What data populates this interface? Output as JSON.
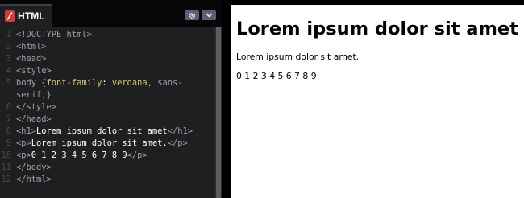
{
  "editor": {
    "tab_label": "HTML",
    "badge_icon": "slash",
    "controls": [
      "gear-icon",
      "chevron-down-icon"
    ],
    "lines": [
      {
        "num": "1",
        "parts": [
          {
            "t": "<!DOCTYPE html>",
            "c": "tag"
          }
        ]
      },
      {
        "num": "2",
        "parts": [
          {
            "t": "<html>",
            "c": "tag"
          }
        ]
      },
      {
        "num": "3",
        "parts": [
          {
            "t": "<head>",
            "c": "tag"
          }
        ]
      },
      {
        "num": "4",
        "parts": [
          {
            "t": "<style>",
            "c": "tag"
          }
        ]
      },
      {
        "num": "5",
        "parts": [
          {
            "t": "body {",
            "c": "tag"
          },
          {
            "t": "font-family",
            "c": "prop"
          },
          {
            "t": ": ",
            "c": "text"
          },
          {
            "t": "verdana",
            "c": "prop"
          },
          {
            "t": ", sans-",
            "c": "val"
          }
        ]
      },
      {
        "num": "",
        "parts": [
          {
            "t": "serif;}",
            "c": "val"
          }
        ]
      },
      {
        "num": "6",
        "parts": [
          {
            "t": "</style>",
            "c": "tag"
          }
        ]
      },
      {
        "num": "7",
        "parts": [
          {
            "t": "</head>",
            "c": "tag"
          }
        ]
      },
      {
        "num": "8",
        "parts": [
          {
            "t": "<h1>",
            "c": "tag"
          },
          {
            "t": "Lorem ipsum dolor sit amet",
            "c": "text"
          },
          {
            "t": "</h1>",
            "c": "tag"
          }
        ]
      },
      {
        "num": "9",
        "parts": [
          {
            "t": "<p>",
            "c": "tag"
          },
          {
            "t": "Lorem ipsum dolor sit amet.",
            "c": "text"
          },
          {
            "t": "</p>",
            "c": "tag"
          }
        ]
      },
      {
        "num": "10",
        "parts": [
          {
            "t": "<p>",
            "c": "tag"
          },
          {
            "t": "0 1 2 3 4 5 6 7 8 9",
            "c": "text"
          },
          {
            "t": "</p>",
            "c": "tag"
          }
        ]
      },
      {
        "num": "11",
        "parts": [
          {
            "t": "</body>",
            "c": "tag"
          }
        ]
      },
      {
        "num": "12",
        "parts": [
          {
            "t": "</html>",
            "c": "tag"
          }
        ]
      }
    ]
  },
  "preview": {
    "heading": "Lorem ipsum dolor sit amet",
    "paragraph": "Lorem ipsum dolor sit amet.",
    "digits": "0 1 2 3 4 5 6 7 8 9"
  },
  "colors": {
    "tag": "#9fa3a9",
    "text": "#ffffff",
    "prop": "#d6c16a",
    "val": "#9fa3a9",
    "badge": "#d7373f"
  }
}
